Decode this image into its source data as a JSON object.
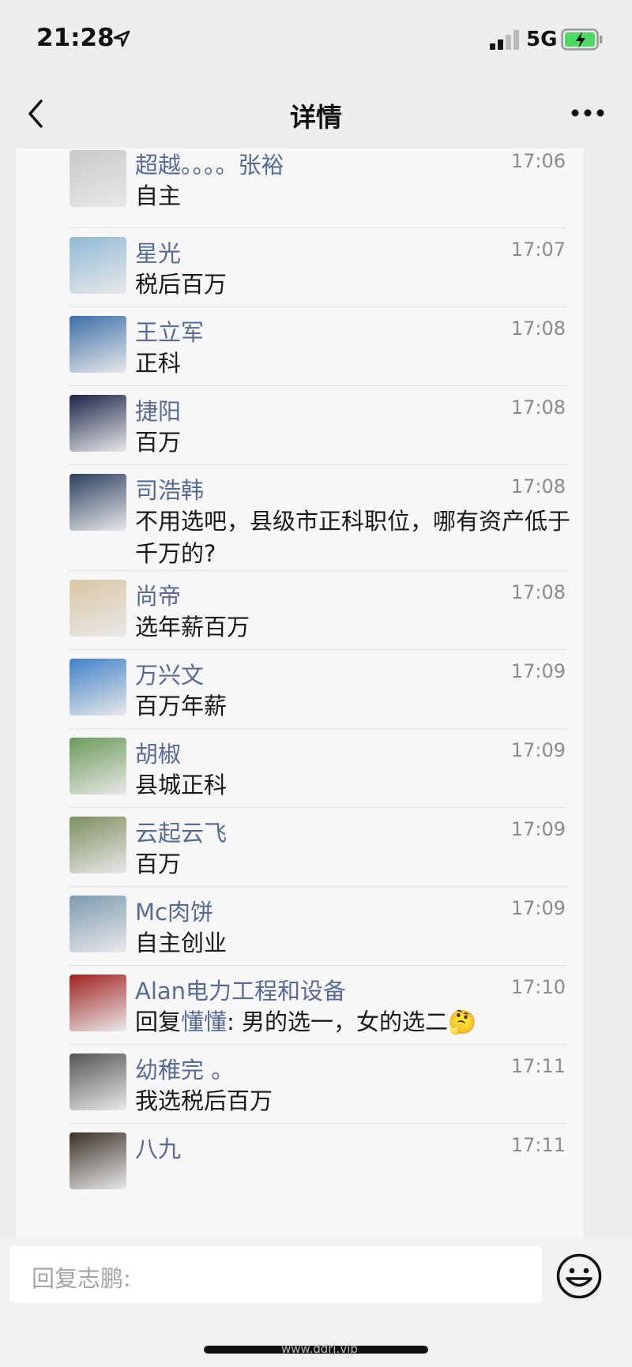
{
  "status_bar": {
    "time": "21:28",
    "network": "5G"
  },
  "nav": {
    "title": "详情"
  },
  "comments": [
    {
      "name": "超越。。。。张裕",
      "time": "17:06",
      "text": "自主",
      "avatar_color": "#c9c9c9"
    },
    {
      "name": "星光",
      "time": "17:07",
      "text": "税后百万",
      "avatar_color": "#8fbad6"
    },
    {
      "name": "王立军",
      "time": "17:08",
      "text": "正科",
      "avatar_color": "#3b6fa8"
    },
    {
      "name": "捷阳",
      "time": "17:08",
      "text": "百万",
      "avatar_color": "#1a2448"
    },
    {
      "name": "司浩韩",
      "time": "17:08",
      "text": "不用选吧，县级市正科职位，哪有资产低于千万的?",
      "avatar_color": "#2b3f5e"
    },
    {
      "name": "尚帝",
      "time": "17:08",
      "text": "选年薪百万",
      "avatar_color": "#d9c7a2"
    },
    {
      "name": "万兴文",
      "time": "17:09",
      "text": "百万年薪",
      "avatar_color": "#3f82c9"
    },
    {
      "name": "胡椒",
      "time": "17:09",
      "text": "县城正科",
      "avatar_color": "#6b9a57"
    },
    {
      "name": "云起云飞",
      "time": "17:09",
      "text": "百万",
      "avatar_color": "#7d8f5e"
    },
    {
      "name": "Mc肉饼",
      "time": "17:09",
      "text": "自主创业",
      "avatar_color": "#7c9bb1"
    },
    {
      "name": "Alan电力工程和设备",
      "time": "17:10",
      "text_prefix": "回复",
      "reply_to": "懂懂",
      "text": ": 男的选一，女的选二",
      "emoji": "🤔",
      "avatar_color": "#a0221f"
    },
    {
      "name": "幼稚完 。",
      "time": "17:11",
      "text": "我选税后百万",
      "avatar_color": "#555555"
    },
    {
      "name": "八九",
      "time": "17:11",
      "text": "",
      "avatar_color": "#3a3228"
    }
  ],
  "input": {
    "placeholder": "回复志鹏:"
  },
  "watermark": "www.ddrj.vip",
  "colors": {
    "name": "#576b95",
    "background": "#ededed",
    "list_bg": "#f7f7f7"
  }
}
